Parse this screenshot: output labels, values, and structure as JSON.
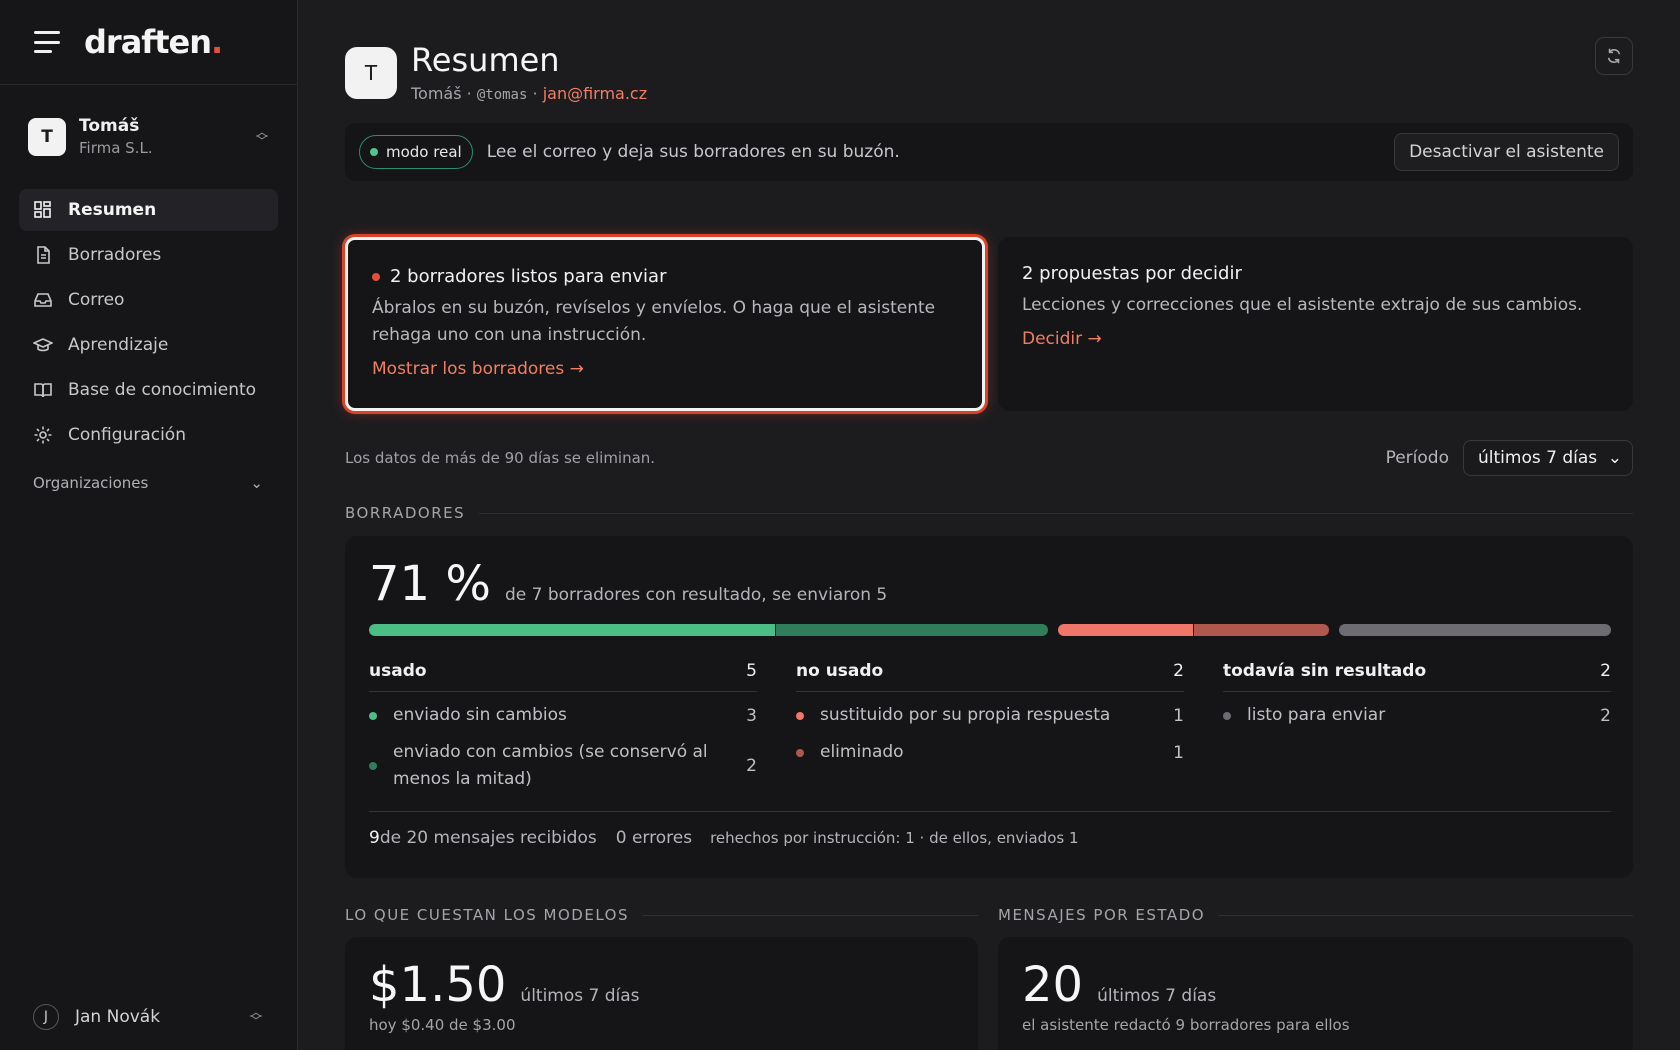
{
  "sidebar": {
    "logo": "draften",
    "logo_dot": ".",
    "account": {
      "initial": "T",
      "name": "Tomáš",
      "org": "Firma S.L."
    },
    "nav": [
      {
        "label": "Resumen",
        "icon": "dashboard-icon",
        "active": true
      },
      {
        "label": "Borradores",
        "icon": "document-icon"
      },
      {
        "label": "Correo",
        "icon": "inbox-icon"
      },
      {
        "label": "Aprendizaje",
        "icon": "graduation-cap-icon"
      },
      {
        "label": "Base de conocimiento",
        "icon": "book-icon"
      },
      {
        "label": "Configuración",
        "icon": "gear-icon"
      }
    ],
    "organizations_label": "Organizaciones",
    "bottom_user": {
      "initial": "J",
      "name": "Jan Novák"
    }
  },
  "header": {
    "initial": "T",
    "title": "Resumen",
    "name": "Tomáš",
    "sep": " · ",
    "handle": "@tomas",
    "email": "jan@firma.cz"
  },
  "mode": {
    "pill": "modo real",
    "text": "Lee el correo y deja sus borradores en su buzón.",
    "button": "Desactivar el asistente"
  },
  "cards": {
    "drafts": {
      "title": "2 borradores listos para enviar",
      "desc": "Ábralos en su buzón, revíselos y envíelos. O haga que el asistente rehaga uno con una instrucción.",
      "link": "Mostrar los borradores →"
    },
    "proposals": {
      "title": "2 propuestas por decidir",
      "desc": "Lecciones y correcciones que el asistente extrajo de sus cambios.",
      "link": "Decidir →"
    }
  },
  "period": {
    "retention": "Los datos de más de 90 días se eliminan.",
    "label": "Período",
    "selected": "últimos 7 días"
  },
  "drafts_section": {
    "heading": "BORRADORES",
    "big": "71 %",
    "caption": "de 7 borradores con resultado, se enviaron 5",
    "bar": [
      {
        "name": "enviado sin cambios",
        "value": 3,
        "color": "#4dbd86"
      },
      {
        "name": "enviado con cambios",
        "value": 2,
        "color": "#2f7d5b"
      },
      {
        "name": "sustituido por su propia respuesta",
        "value": 1,
        "color": "#f0766a"
      },
      {
        "name": "eliminado",
        "value": 1,
        "color": "#b0574e"
      },
      {
        "name": "listo para enviar",
        "value": 2,
        "color": "#6c6c72"
      }
    ],
    "columns": [
      {
        "title": "usado",
        "count": "5",
        "rows": [
          {
            "label": "enviado sin cambios",
            "count": "3",
            "color": "#4dbd86"
          },
          {
            "label": "enviado con cambios (se conservó al menos la mitad)",
            "count": "2",
            "color": "#2f7d5b"
          }
        ]
      },
      {
        "title": "no usado",
        "count": "2",
        "rows": [
          {
            "label": "sustituido por su propia respuesta",
            "count": "1",
            "color": "#f0766a"
          },
          {
            "label": "eliminado",
            "count": "1",
            "color": "#b0574e"
          }
        ]
      },
      {
        "title": "todavía sin resultado",
        "count": "2",
        "rows": [
          {
            "label": "listo para enviar",
            "count": "2",
            "color": "#6c6c72"
          }
        ]
      }
    ],
    "footer": {
      "received_num": "9",
      "received_text": " de 20 mensajes recibidos",
      "errors": "0 errores",
      "redone": "rehechos por instrucción: 1 · de ellos, enviados 1"
    }
  },
  "cost_section": {
    "heading": "LO QUE CUESTAN LOS MODELOS",
    "big": "$1.50",
    "caption": "últimos 7 días",
    "sub": "hoy $0.40 de $3.00"
  },
  "messages_section": {
    "heading": "MENSAJES POR ESTADO",
    "big": "20",
    "caption": "últimos 7 días",
    "sub": "el asistente redactó 9 borradores para ellos"
  }
}
